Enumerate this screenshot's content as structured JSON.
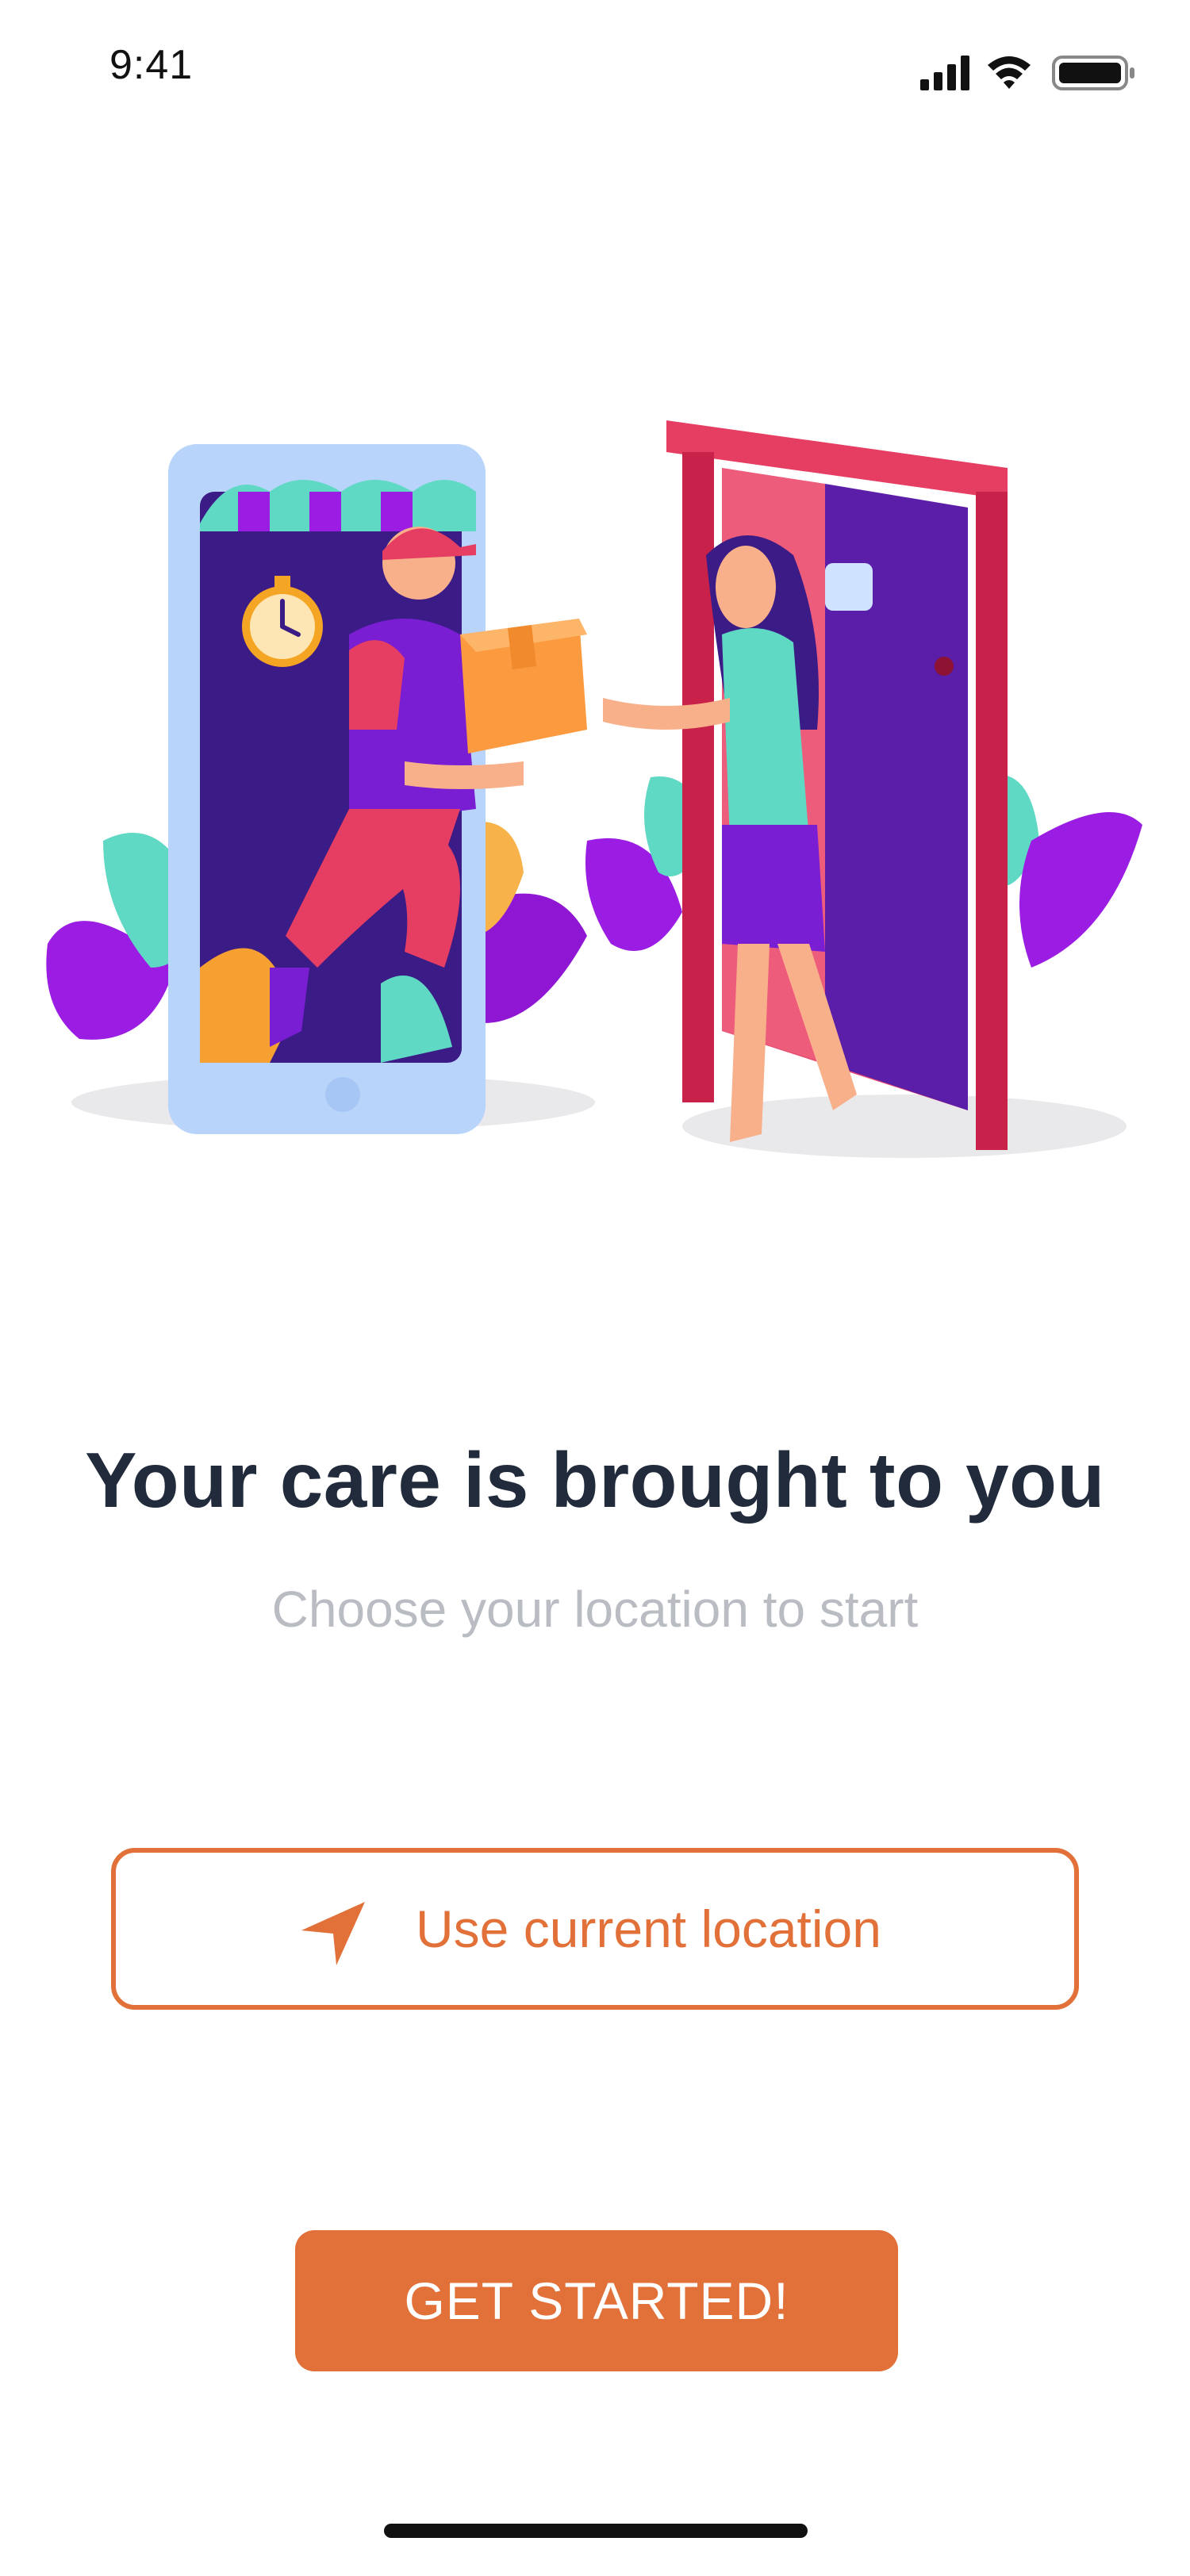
{
  "status_bar": {
    "time": "9:41",
    "icons": [
      "signal-icon",
      "wifi-icon",
      "battery-icon"
    ]
  },
  "hero": {
    "illustration": "delivery-illustration"
  },
  "headline": "Your care is brought to you",
  "subheadline": "Choose your location to start",
  "location_button": {
    "label": "Use current location",
    "icon": "navigation-arrow-icon"
  },
  "start_button": {
    "label": "GET STARTED!"
  },
  "colors": {
    "accent": "#e27139",
    "headline": "#222b3c",
    "subheadline": "#b9bcc2"
  }
}
